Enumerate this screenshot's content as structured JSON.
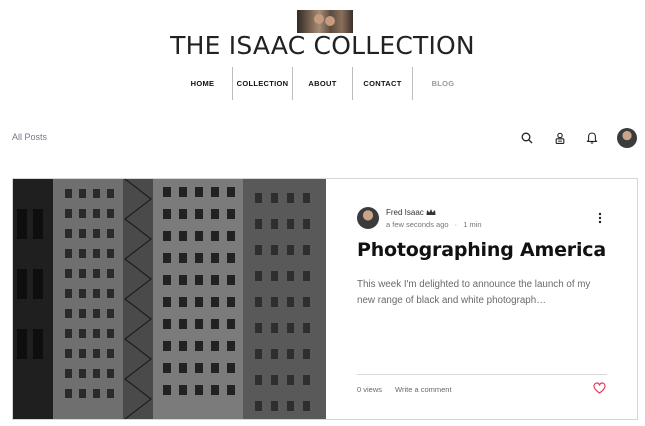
{
  "site": {
    "title": "THE ISAAC COLLECTION"
  },
  "nav": {
    "items": [
      {
        "label": "HOME"
      },
      {
        "label": "COLLECTION"
      },
      {
        "label": "ABOUT"
      },
      {
        "label": "CONTACT"
      },
      {
        "label": "BLOG"
      }
    ]
  },
  "blog": {
    "filter_label": "All Posts",
    "icons": [
      "search-icon",
      "member-icon",
      "notification-bell-icon",
      "profile-avatar"
    ]
  },
  "post": {
    "author": "Fred Isaac",
    "author_badge_icon": "crown-icon",
    "time": "a few seconds ago",
    "separator": "·",
    "read_time": "1 min",
    "title": "Photographing America",
    "excerpt": "This week I'm delighted to announce the launch of my new range of black and white photograph…",
    "views": "0 views",
    "comment_label": "Write a comment",
    "like_icon": "heart-icon",
    "heart_color": "#e0405a"
  }
}
